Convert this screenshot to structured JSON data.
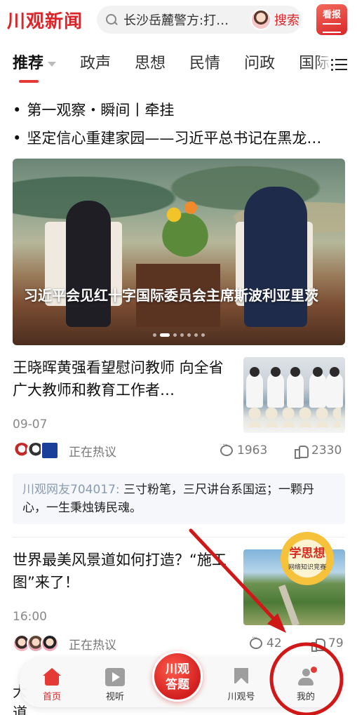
{
  "header": {
    "logo": "川观新闻",
    "search_text": "长沙岳麓警方:打…",
    "search_button": "搜索",
    "newspaper_label": "看报"
  },
  "tabs": [
    "推荐",
    "政声",
    "思想",
    "民情",
    "问政",
    "国际"
  ],
  "headlines": [
    "第一观察・瞬间丨牵挂",
    "坚定信心重建家园——习近平总书记在黑龙…"
  ],
  "banner": {
    "caption": "习近平会见红十字国际委员会主席斯波利亚里茨",
    "slides": 7,
    "active_slide": 2
  },
  "articles": [
    {
      "title": "王晓晖黄强看望慰问教师 向全省广大教师和教育工作者…",
      "time": "09-07",
      "hot_label": "正在热议",
      "comments": "1963",
      "likes": "2330"
    },
    {
      "title": "世界最美风景道如何打造？“施工图”来了！",
      "time": "16:00",
      "hot_label": "正在热议",
      "comments": "42",
      "likes": "79",
      "badge_title": "学思想",
      "badge_sub": "网络知识竞赛"
    }
  ],
  "comment": {
    "user": "川观网友704017:",
    "text": "三寸粉笔，三尺讲台系国运；一颗丹心，一生秉烛铸民魂。"
  },
  "partial_next": {
    "line1": "大",
    "line2": "道"
  },
  "bottom_nav": {
    "home": "首页",
    "video": "视听",
    "quiz_line1": "川观",
    "quiz_line2": "答题",
    "chuanguan_hao": "川观号",
    "mine": "我的"
  },
  "colors": {
    "brand_red": "#d9262a",
    "annotation_red": "#d01818"
  }
}
